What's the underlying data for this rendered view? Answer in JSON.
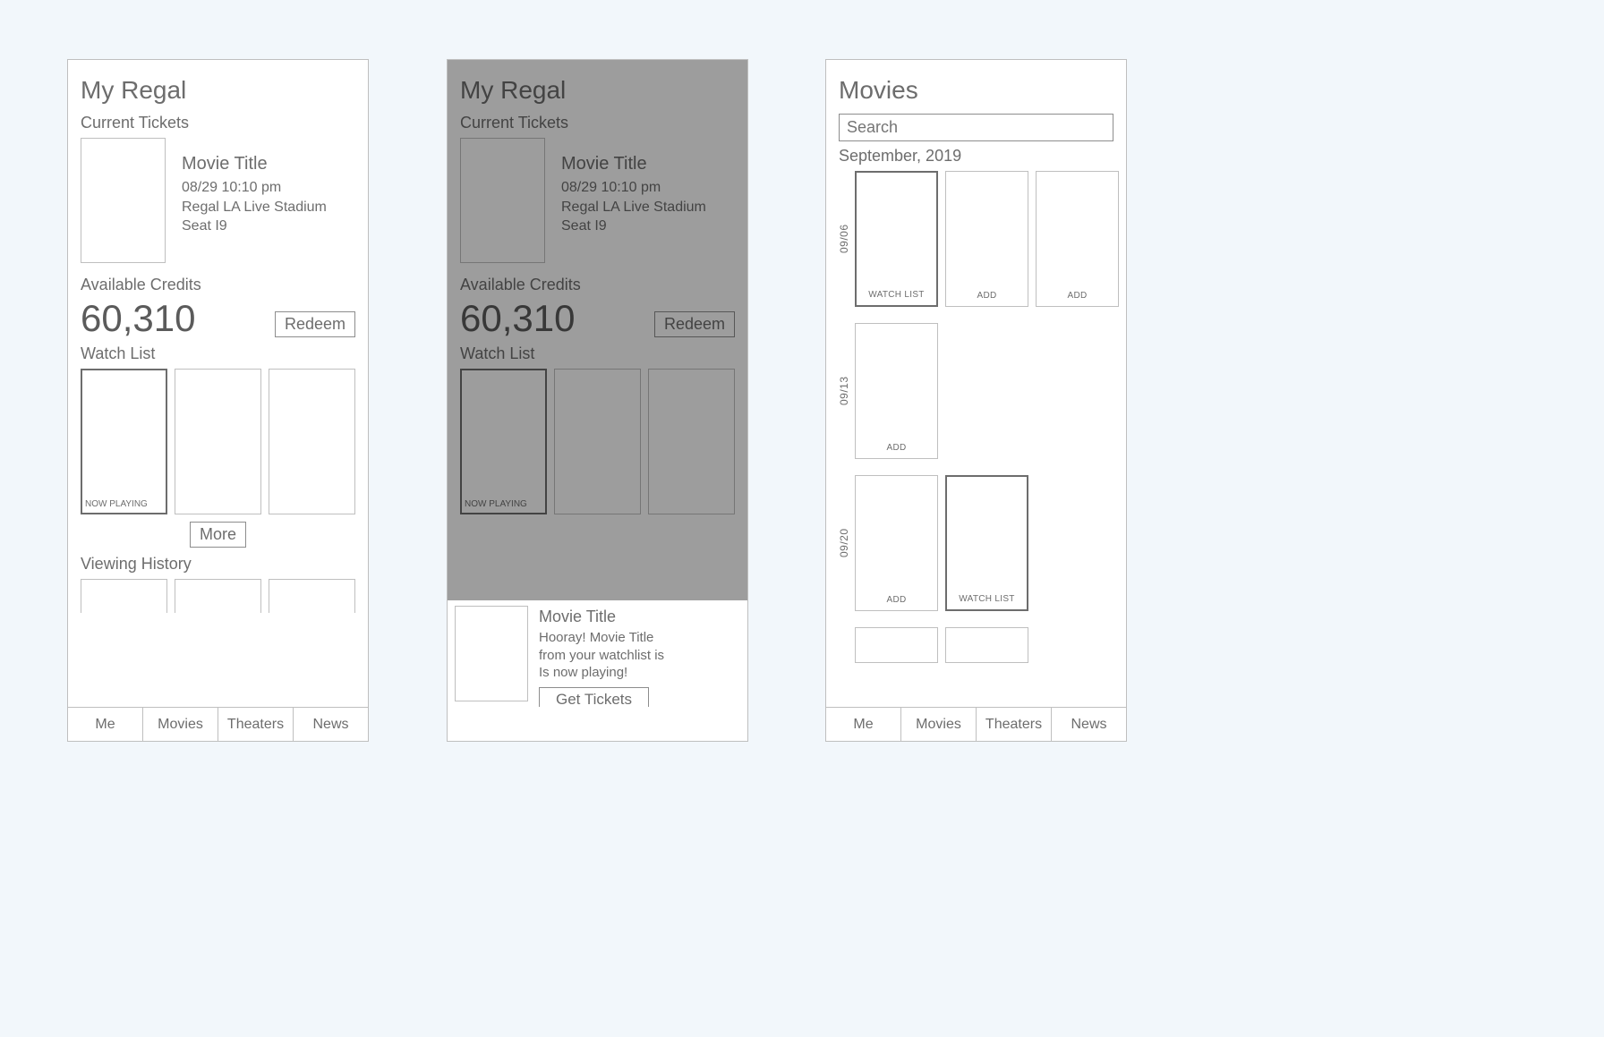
{
  "screen1": {
    "title": "My Regal",
    "current_tickets_label": "Current Tickets",
    "ticket": {
      "title": "Movie Title",
      "datetime": "08/29 10:10 pm",
      "theater": "Regal LA Live Stadium",
      "seat": "Seat I9"
    },
    "credits_label": "Available Credits",
    "credits_value": "60,310",
    "redeem_label": "Redeem",
    "watch_list_label": "Watch List",
    "watch_cards": [
      "NOW PLAYING",
      "",
      ""
    ],
    "more_label": "More",
    "viewing_history_label": "Viewing History",
    "tabs": [
      "Me",
      "Movies",
      "Theaters",
      "News"
    ]
  },
  "screen2": {
    "title": "My Regal",
    "current_tickets_label": "Current Tickets",
    "ticket": {
      "title": "Movie Title",
      "datetime": "08/29 10:10 pm",
      "theater": "Regal LA Live Stadium",
      "seat": "Seat I9"
    },
    "credits_label": "Available Credits",
    "credits_value": "60,310",
    "redeem_label": "Redeem",
    "watch_list_label": "Watch List",
    "watch_cards": [
      "NOW PLAYING",
      "",
      ""
    ],
    "popup": {
      "title": "Movie Title",
      "line1": "Hooray! Movie Title",
      "line2": "from your watchlist is",
      "line3": "Is now playing!",
      "cta": "Get Tickets"
    }
  },
  "screen3": {
    "title": "Movies",
    "search_placeholder": "Search",
    "month": "September, 2019",
    "dates": [
      "09/06",
      "09/13",
      "09/20"
    ],
    "rows": [
      [
        "WATCH LIST",
        "ADD",
        "ADD"
      ],
      [
        "ADD"
      ],
      [
        "ADD",
        "WATCH LIST"
      ]
    ],
    "tabs": [
      "Me",
      "Movies",
      "Theaters",
      "News"
    ]
  }
}
